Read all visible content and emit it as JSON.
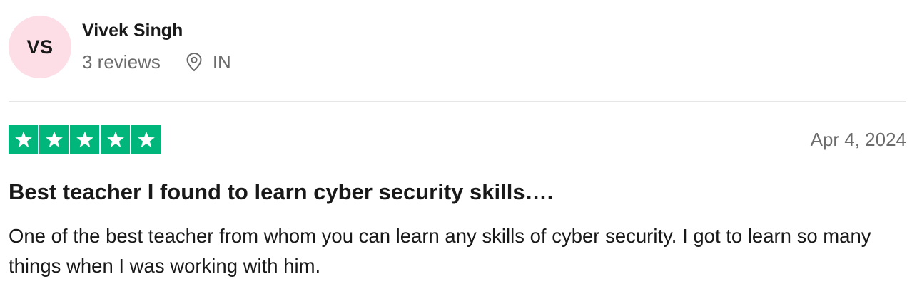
{
  "reviewer": {
    "initials": "VS",
    "name": "Vivek Singh",
    "review_count": "3 reviews",
    "country": "IN",
    "avatar_color": "#fddde6"
  },
  "review": {
    "rating": 5,
    "max_rating": 5,
    "star_color": "#00b67a",
    "date": "Apr 4, 2024",
    "title": "Best teacher I found to learn cyber security skills….",
    "body": "One of the best teacher from whom you can learn any skills of cyber security. I got to learn so many things when I was working with him."
  },
  "icons": {
    "location": "location-pin-icon",
    "star": "star-icon"
  }
}
